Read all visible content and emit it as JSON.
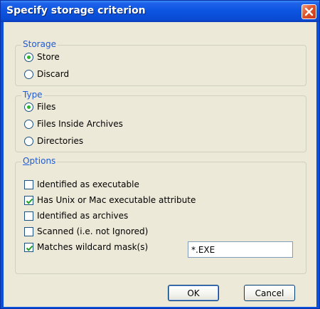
{
  "window": {
    "title": "Specify storage criterion"
  },
  "storage": {
    "title": "Storage",
    "options": [
      {
        "label": "Store",
        "selected": true
      },
      {
        "label": "Discard",
        "selected": false
      }
    ]
  },
  "type": {
    "title": "Type",
    "options": [
      {
        "label": "Files",
        "selected": true
      },
      {
        "label": "Files Inside Archives",
        "selected": false
      },
      {
        "label": "Directories",
        "selected": false
      }
    ]
  },
  "options": {
    "title_accel": "O",
    "title_rest": "ptions",
    "checks": [
      {
        "label": "Identified as executable",
        "checked": false
      },
      {
        "label": "Has Unix or Mac executable attribute",
        "checked": true
      },
      {
        "label": "Identified as archives",
        "checked": false
      },
      {
        "label": "Scanned (i.e. not Ignored)",
        "checked": false
      },
      {
        "label": "Matches wildcard mask(s)",
        "checked": true
      }
    ],
    "mask_value": "*.EXE"
  },
  "buttons": {
    "ok": "OK",
    "cancel": "Cancel"
  },
  "colors": {
    "titlebar": "#0b54e0",
    "group_title": "#1f5bd6",
    "dialog_bg": "#ece9d8",
    "close": "#e0542c"
  },
  "icons": {
    "close": "close-icon",
    "check": "checkmark-icon"
  }
}
